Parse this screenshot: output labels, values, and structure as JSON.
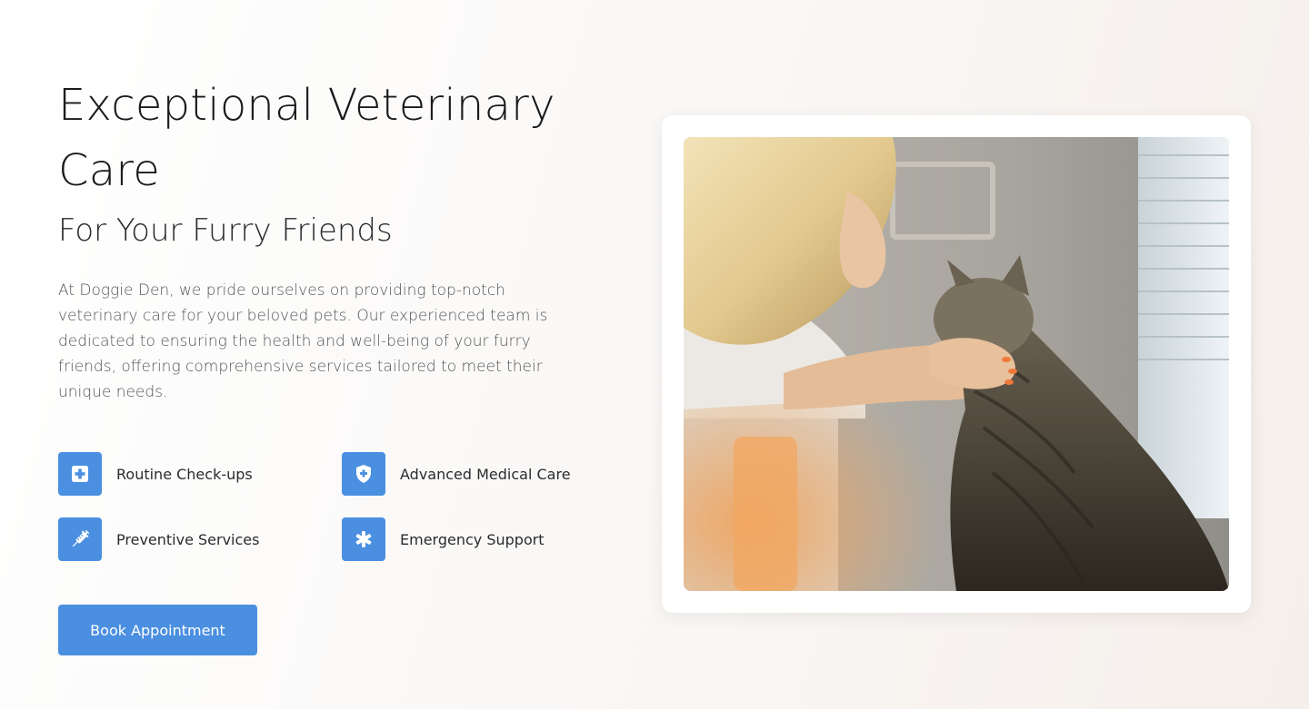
{
  "hero": {
    "title": "Exceptional Veterinary Care",
    "subtitle": "For Your Furry Friends",
    "description": "At Doggie Den, we pride ourselves on providing top-notch veterinary care for your beloved pets. Our experienced team is dedicated to ensuring the health and well-being of your furry friends, offering comprehensive services tailored to meet their unique needs.",
    "features": [
      {
        "label": "Routine Check-ups",
        "icon": "medical-kit-icon"
      },
      {
        "label": "Advanced Medical Care",
        "icon": "shield-plus-icon"
      },
      {
        "label": "Preventive Services",
        "icon": "syringe-icon"
      },
      {
        "label": "Emergency Support",
        "icon": "asterisk-icon"
      }
    ],
    "cta_label": "Book Appointment"
  },
  "colors": {
    "accent": "#4a8fe0",
    "text": "#1a1a1a",
    "muted_text": "#555555"
  },
  "image": {
    "subject": "woman-petting-tabby-cat-photo"
  }
}
